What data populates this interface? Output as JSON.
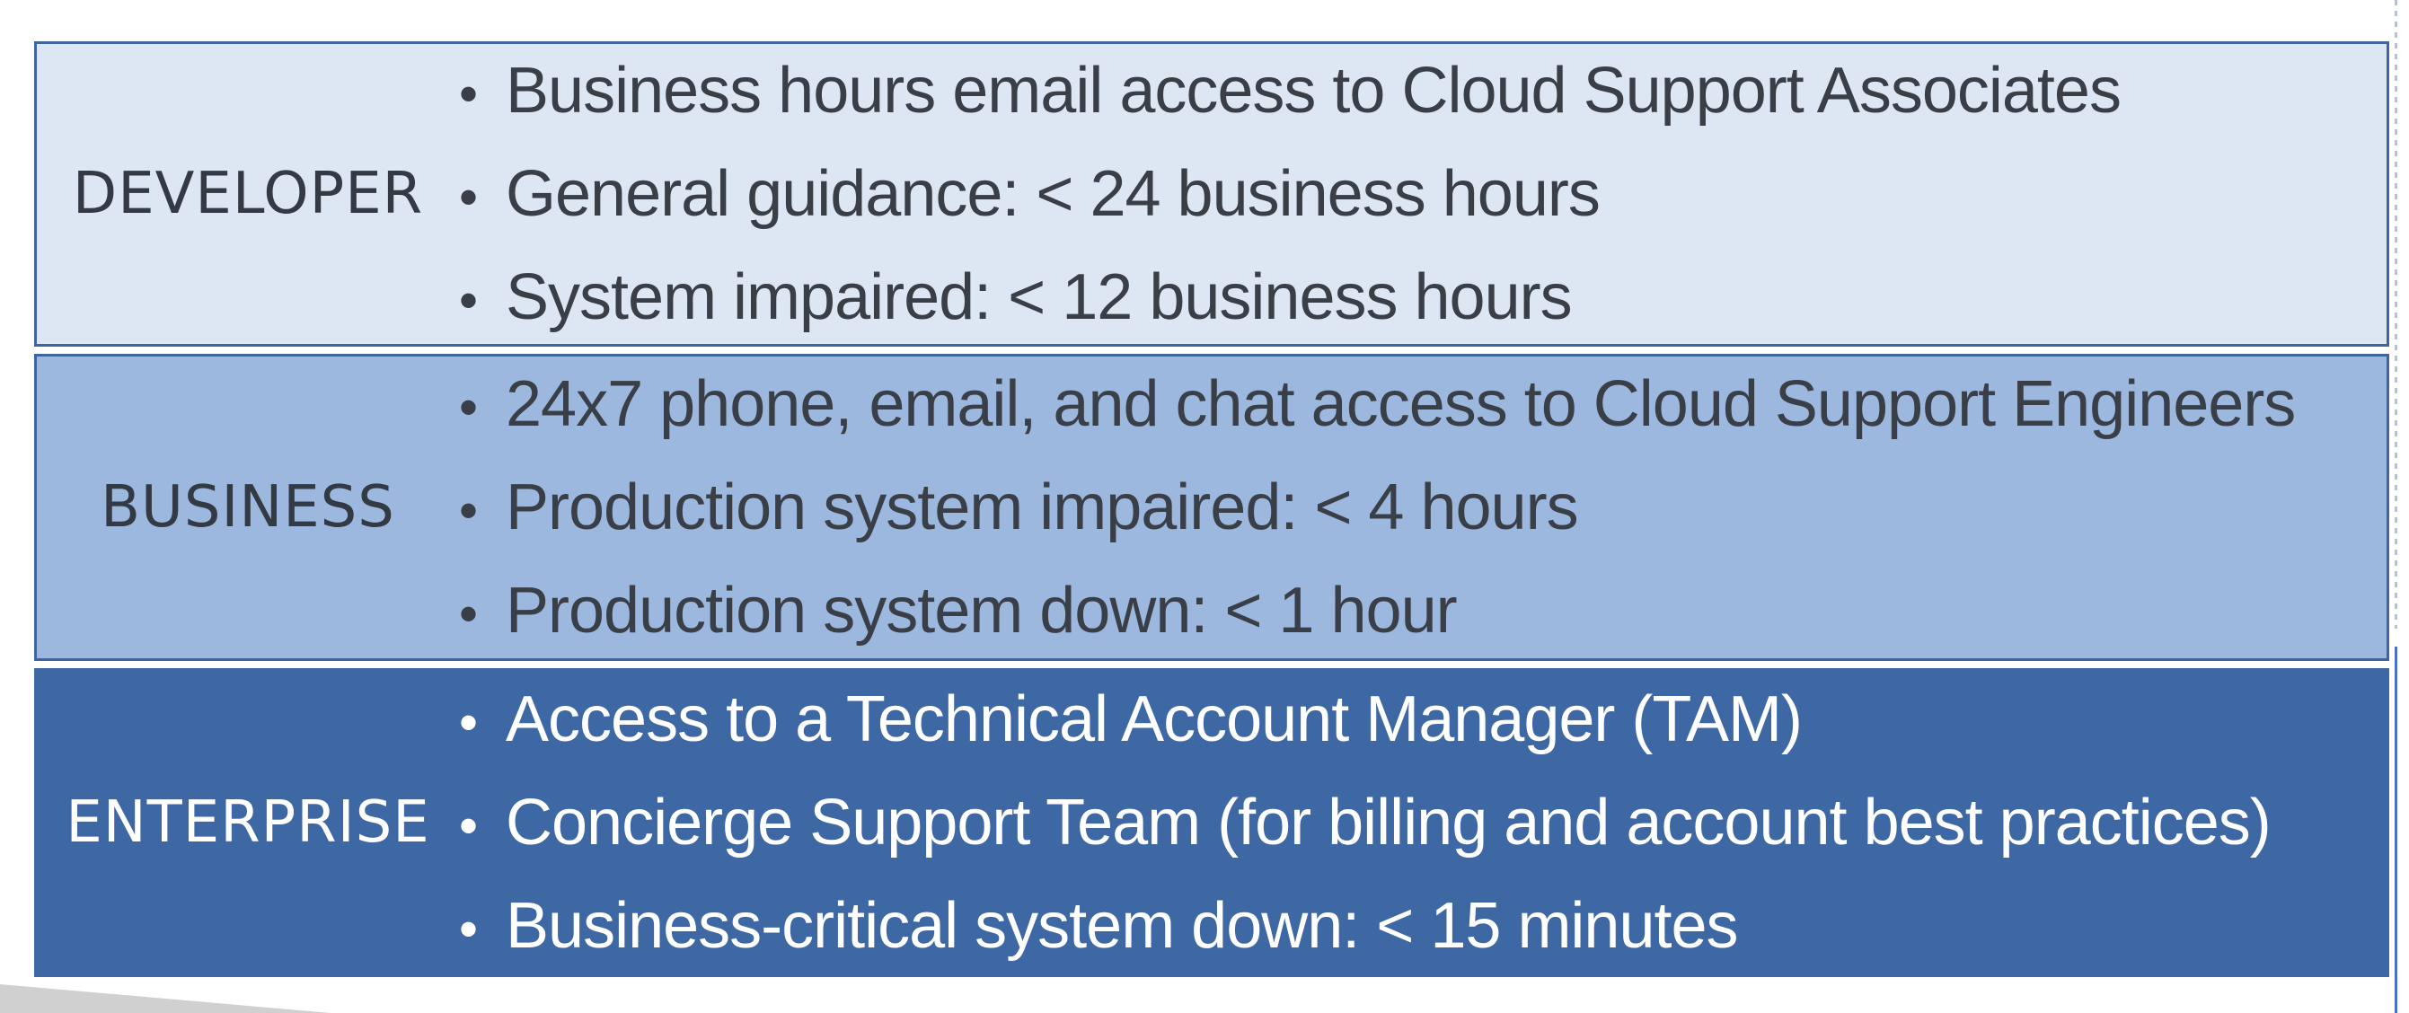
{
  "tiers": [
    {
      "name": "DEVELOPER",
      "items": [
        "Business hours email access to Cloud Support Associates",
        "General guidance: < 24 business hours",
        "System impaired: < 12 business hours"
      ]
    },
    {
      "name": "BUSINESS",
      "items": [
        "24x7 phone, email, and chat access to Cloud Support Engineers",
        "Production system impaired: < 4 hours",
        "Production system down: < 1 hour"
      ]
    },
    {
      "name": "ENTERPRISE",
      "items": [
        "Access to a Technical Account Manager (TAM)",
        "Concierge Support Team (for billing and account best practices)",
        "Business-critical system down: < 15 minutes"
      ]
    }
  ],
  "bullet": "•",
  "colors": {
    "developer_bg": "#dde7f3",
    "business_bg": "#9cb8df",
    "enterprise_bg": "#3e68a4",
    "border": "#3f65a1"
  }
}
